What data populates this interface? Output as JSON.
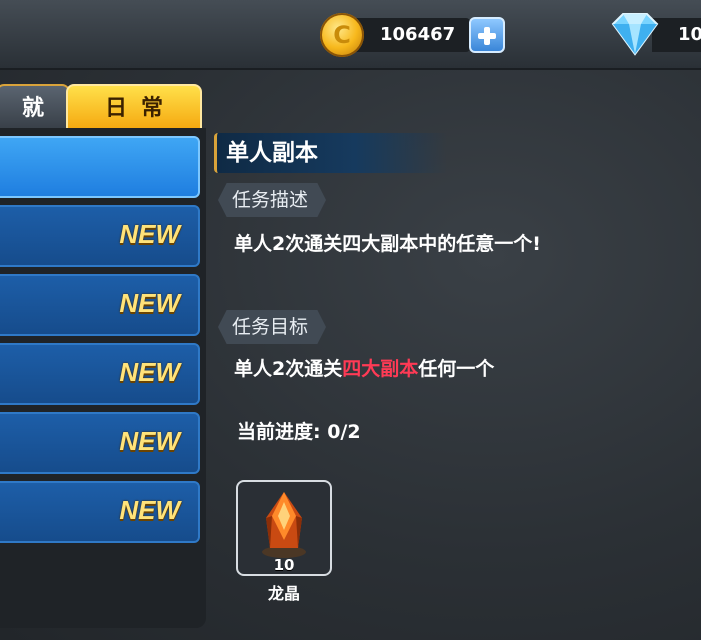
{
  "currency": {
    "coin_value": "106467",
    "gem_value": "10"
  },
  "tabs": {
    "achievement": "就",
    "daily": "日常"
  },
  "task_list": {
    "items": [
      {
        "badge": ""
      },
      {
        "badge": "NEW"
      },
      {
        "badge": "NEW"
      },
      {
        "badge": "NEW"
      },
      {
        "badge": "NEW"
      },
      {
        "badge": "NEW"
      }
    ]
  },
  "task": {
    "title": "单人副本",
    "description_label": "任务描述",
    "description": "单人2次通关四大副本中的任意一个!",
    "objective_label": "任务目标",
    "objective_prefix": "单人2次通关",
    "objective_highlight": "四大副本",
    "objective_suffix": "任何一个",
    "progress": "当前进度: 0/2"
  },
  "reward": {
    "count": "10",
    "name": "龙晶",
    "icon": "dragon-crystal-icon"
  },
  "colors": {
    "highlight": "#ff3a55",
    "tab_active": "#f5a70e",
    "list_item": "#1d5ea8",
    "list_item_selected": "#2f8ee8"
  }
}
